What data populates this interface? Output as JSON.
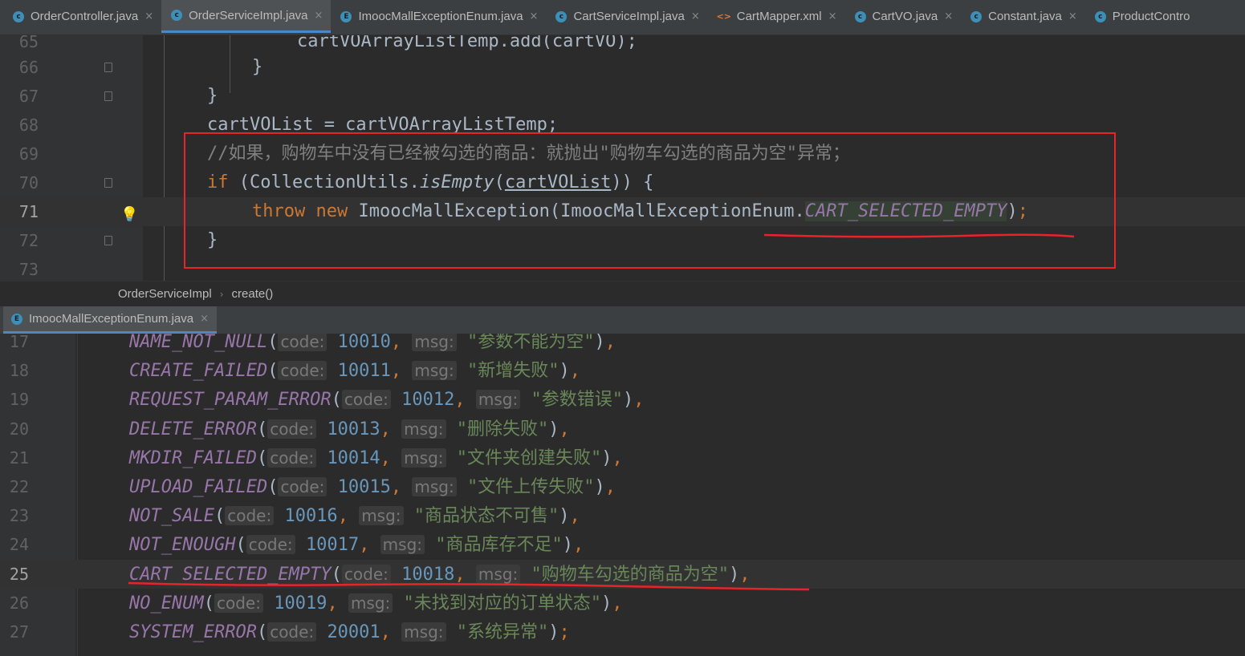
{
  "tabs": [
    {
      "label": "OrderController.java",
      "type": "class",
      "active": false
    },
    {
      "label": "OrderServiceImpl.java",
      "type": "class",
      "active": true
    },
    {
      "label": "ImoocMallExceptionEnum.java",
      "type": "enum",
      "active": false
    },
    {
      "label": "CartServiceImpl.java",
      "type": "class",
      "active": false
    },
    {
      "label": "CartMapper.xml",
      "type": "xml",
      "active": false
    },
    {
      "label": "CartVO.java",
      "type": "class",
      "active": false
    },
    {
      "label": "Constant.java",
      "type": "class",
      "active": false
    },
    {
      "label": "ProductContro",
      "type": "class",
      "active": false
    }
  ],
  "close_glyph": "×",
  "editor1": {
    "lines": [
      {
        "n": "65",
        "code": "cartVOArrayListTemp.add(cartVO);"
      },
      {
        "n": "66",
        "code": "}"
      },
      {
        "n": "67",
        "code": "}"
      },
      {
        "n": "68",
        "code": "cartVOList = cartVOArrayListTemp;"
      },
      {
        "n": "69",
        "code": "//如果，购物车中没有已经被勾选的商品：就抛出\"购物车勾选的商品为空\"异常；"
      },
      {
        "n": "70",
        "kw": "if",
        "open": " (",
        "cls": "CollectionUtils.",
        "fn": "isEmpty",
        "p1": "(",
        "arg": "cartVOList",
        "p2": ")) {"
      },
      {
        "n": "71",
        "kw1": "throw",
        "kw2": "new",
        "ctor": "ImoocMallException(ImoocMallExceptionEnum.",
        "con": "CART_SELECTED_EMPTY",
        "end1": ")",
        "end2": ";"
      },
      {
        "n": "72",
        "code": "}"
      },
      {
        "n": "73",
        "code": ""
      }
    ]
  },
  "breadcrumb": {
    "class_name": "OrderServiceImpl",
    "method": "create()"
  },
  "tab2": {
    "label": "ImoocMallExceptionEnum.java"
  },
  "editor2": {
    "param_code": "code:",
    "param_msg": "msg:",
    "rows": [
      {
        "n": "17",
        "name": "NAME_NOT_NULL",
        "code": "10010",
        "msg": "\"参数不能为空\"",
        "end": "),"
      },
      {
        "n": "18",
        "name": "CREATE_FAILED",
        "code": "10011",
        "msg": "\"新增失败\"",
        "end": "),"
      },
      {
        "n": "19",
        "name": "REQUEST_PARAM_ERROR",
        "code": "10012",
        "msg": "\"参数错误\"",
        "end": "),"
      },
      {
        "n": "20",
        "name": "DELETE_ERROR",
        "code": "10013",
        "msg": "\"删除失败\"",
        "end": "),"
      },
      {
        "n": "21",
        "name": "MKDIR_FAILED",
        "code": "10014",
        "msg": "\"文件夹创建失败\"",
        "end": "),"
      },
      {
        "n": "22",
        "name": "UPLOAD_FAILED",
        "code": "10015",
        "msg": "\"文件上传失败\"",
        "end": "),"
      },
      {
        "n": "23",
        "name": "NOT_SALE",
        "code": "10016",
        "msg": "\"商品状态不可售\"",
        "end": "),"
      },
      {
        "n": "24",
        "name": "NOT_ENOUGH",
        "code": "10017",
        "msg": "\"商品库存不足\"",
        "end": "),"
      },
      {
        "n": "25",
        "name": "CART_SELECTED_EMPTY",
        "code": "10018",
        "msg": "\"购物车勾选的商品为空\"",
        "end": "),"
      },
      {
        "n": "26",
        "name": "NO_ENUM",
        "code": "10019",
        "msg": "\"未找到对应的订单状态\"",
        "end": "),"
      },
      {
        "n": "27",
        "name": "SYSTEM_ERROR",
        "code": "20001",
        "msg": "\"系统异常\"",
        "end": ");"
      }
    ]
  },
  "colors": {
    "annotation_red": "#e8242a",
    "keyword": "#cc7832",
    "constant": "#9876aa",
    "string": "#6a8759",
    "number": "#6897bb"
  }
}
